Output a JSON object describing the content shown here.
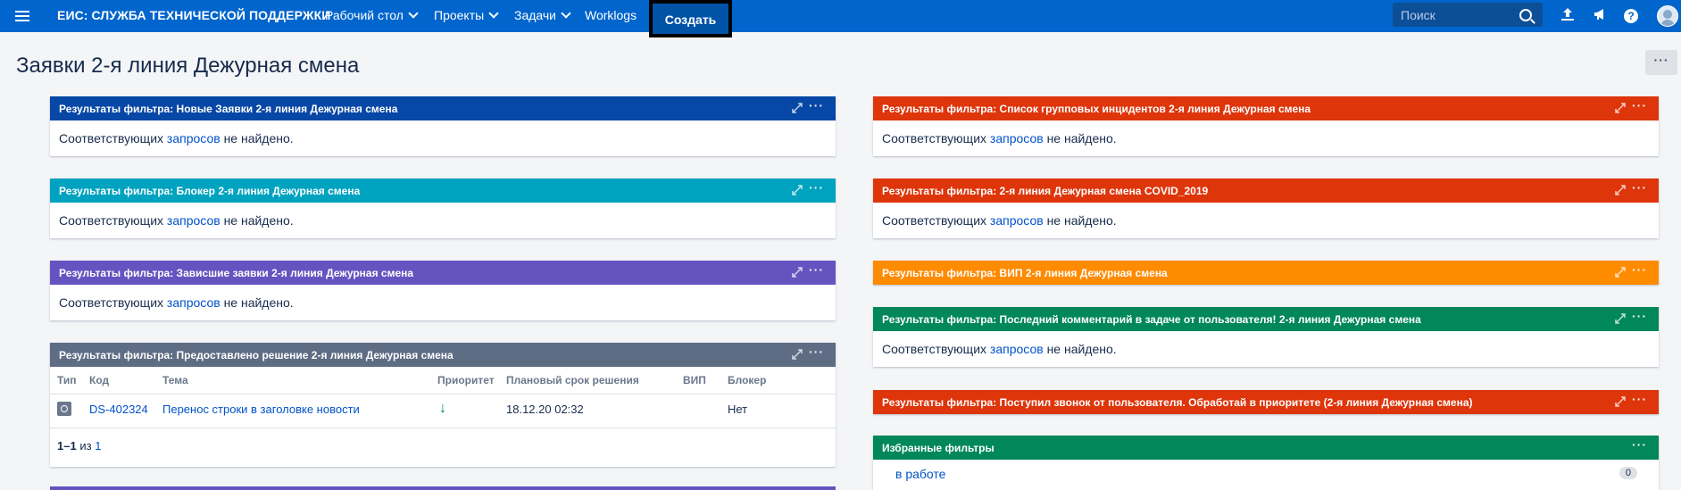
{
  "nav": {
    "brand": "ЕИС: СЛУЖБА ТЕХНИЧЕСКОЙ ПОДДЕРЖКИ",
    "items": [
      "Рабочий стол",
      "Проекты",
      "Задачи",
      "Worklogs"
    ],
    "create": "Создать",
    "search_placeholder": "Поиск",
    "help": "?",
    "colors": {
      "bar": "#0065cc"
    }
  },
  "page": {
    "title": "Заявки 2-я линия Дежурная смена",
    "more": "···"
  },
  "empty": {
    "prefix": "Соответствующих",
    "link": "запросов",
    "suffix": "не найдено."
  },
  "left": [
    {
      "title": "Результаты фильтра: Новые Заявки 2-я линия Дежурная смена",
      "color": "#0747a6"
    },
    {
      "title": "Результаты фильтра: Блокер 2-я линия Дежурная смена",
      "color": "#00a3bf"
    },
    {
      "title": "Результаты фильтра: Зависшие заявки 2-я линия Дежурная смена",
      "color": "#6554c0"
    },
    {
      "title": "Результаты фильтра: Предоставлено решение 2-я линия Дежурная смена",
      "color": "#5e6c84"
    }
  ],
  "table": {
    "headers": [
      "Тип",
      "Код",
      "Тема",
      "Приоритет",
      "Плановый срок решения",
      "ВИП",
      "Блокер"
    ],
    "rows": [
      {
        "key": "DS-402324",
        "summary": "Перенос строки в заголовке новости",
        "priority_icon": "arrow-down-icon",
        "due": "18.12.20 02:32",
        "vip": "",
        "blocker": "Нет"
      }
    ],
    "pager": {
      "range": "1–1",
      "of": "из",
      "total": "1"
    }
  },
  "right": [
    {
      "title": "Результаты фильтра: Список групповых инцидентов 2-я линия Дежурная смена",
      "color": "#de350b"
    },
    {
      "title": "Результаты фильтра: 2-я линия Дежурная смена COVID_2019",
      "color": "#de350b"
    },
    {
      "title": "Результаты фильтра: ВИП 2-я линия Дежурная смена",
      "color": "#ff8b00"
    },
    {
      "title": "Результаты фильтра: Последний комментарий в задаче от пользователя! 2-я линия Дежурная смена",
      "color": "#00875a"
    },
    {
      "title": "Результаты фильтра: Поступил звонок от пользователя. Обработай в приоритете (2-я линия Дежурная смена)",
      "color": "#de350b"
    }
  ],
  "favorites": {
    "title": "Избранные фильтры",
    "items": [
      {
        "label": "в работе",
        "count": "0"
      }
    ]
  },
  "gadget_menu": "···"
}
